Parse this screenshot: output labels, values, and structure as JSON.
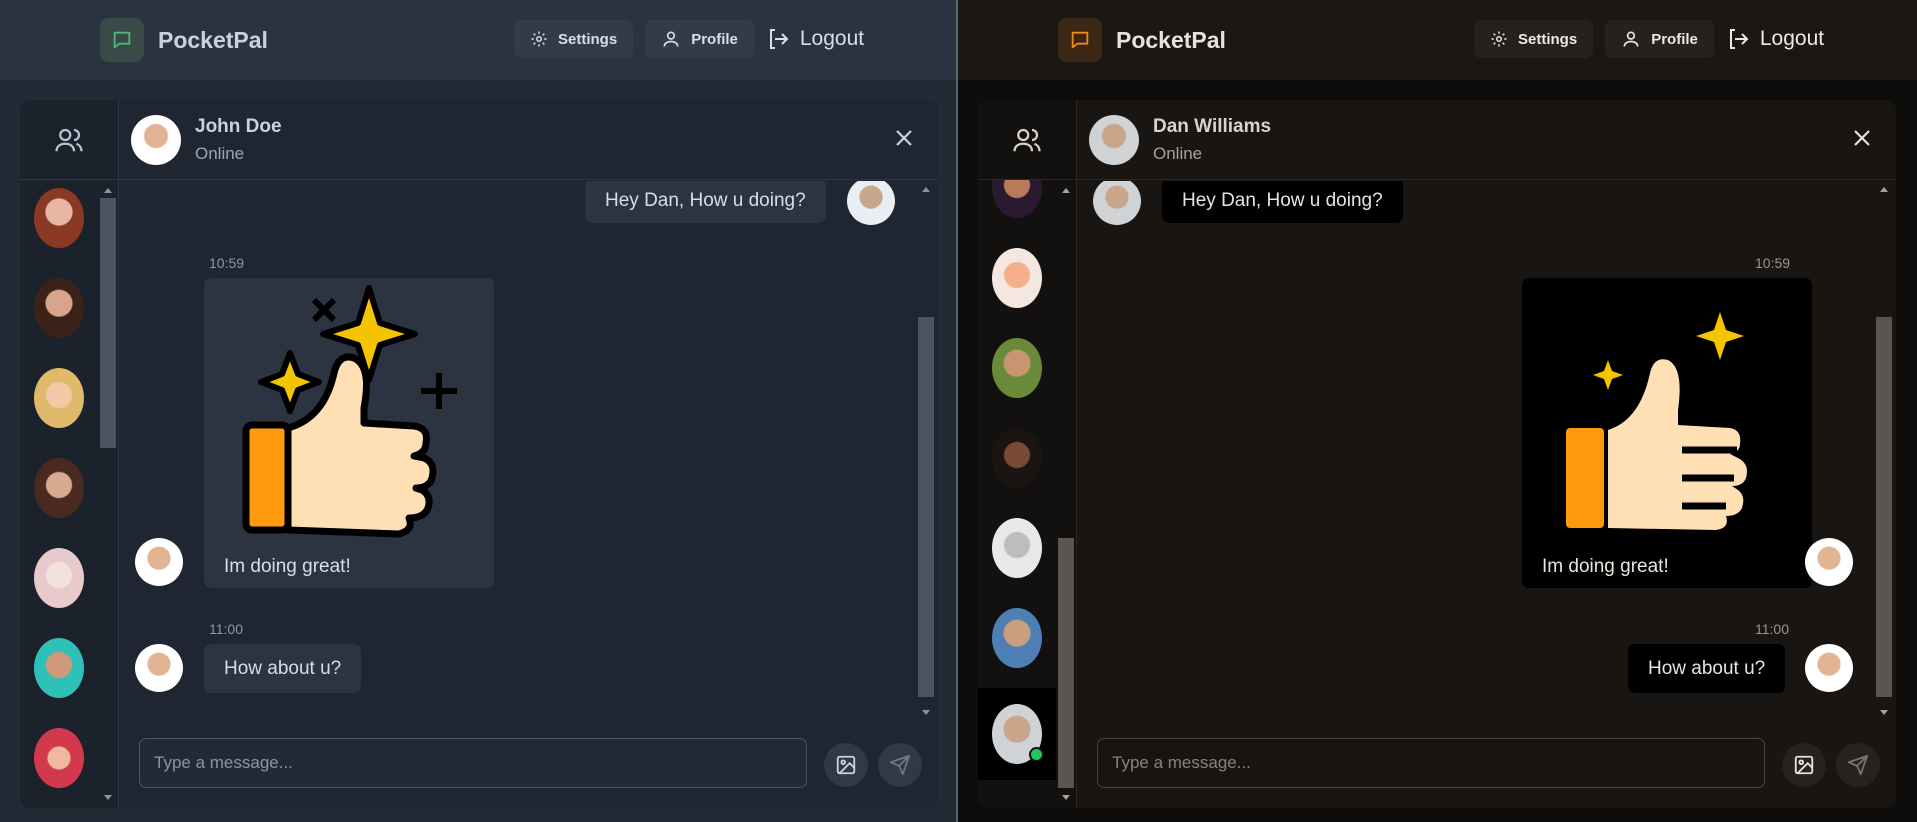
{
  "app_name": "PocketPal",
  "nav": {
    "settings": "Settings",
    "profile": "Profile",
    "logout": "Logout"
  },
  "colors": {
    "left_logo_accent": "#4fb57d",
    "right_logo_accent": "#f08a1a",
    "online_dot": "#1ec95a",
    "star_yellow": "#f5c400",
    "thumb_orange": "#ff9a0f",
    "thumb_skin": "#ffe0b5"
  },
  "light_pane": {
    "chat_name": "John Doe",
    "chat_status": "Online",
    "msg1": "Hey Dan, How u doing?",
    "time1": "10:59",
    "msg2": "Im doing great!",
    "time2": "11:00",
    "msg3": "How about u?",
    "placeholder": "Type a message..."
  },
  "dark_pane": {
    "chat_name": "Dan Williams",
    "chat_status": "Online",
    "msg1": "Hey Dan, How u doing?",
    "time1": "10:59",
    "msg2": "Im doing great!",
    "time2": "11:00",
    "msg3": "How about u?",
    "placeholder": "Type a message..."
  },
  "icons": [
    "chat-bubble-icon",
    "gear-icon",
    "user-icon",
    "logout-icon",
    "users-icon",
    "close-icon",
    "image-icon",
    "send-icon",
    "thumbs-up-sticker"
  ]
}
